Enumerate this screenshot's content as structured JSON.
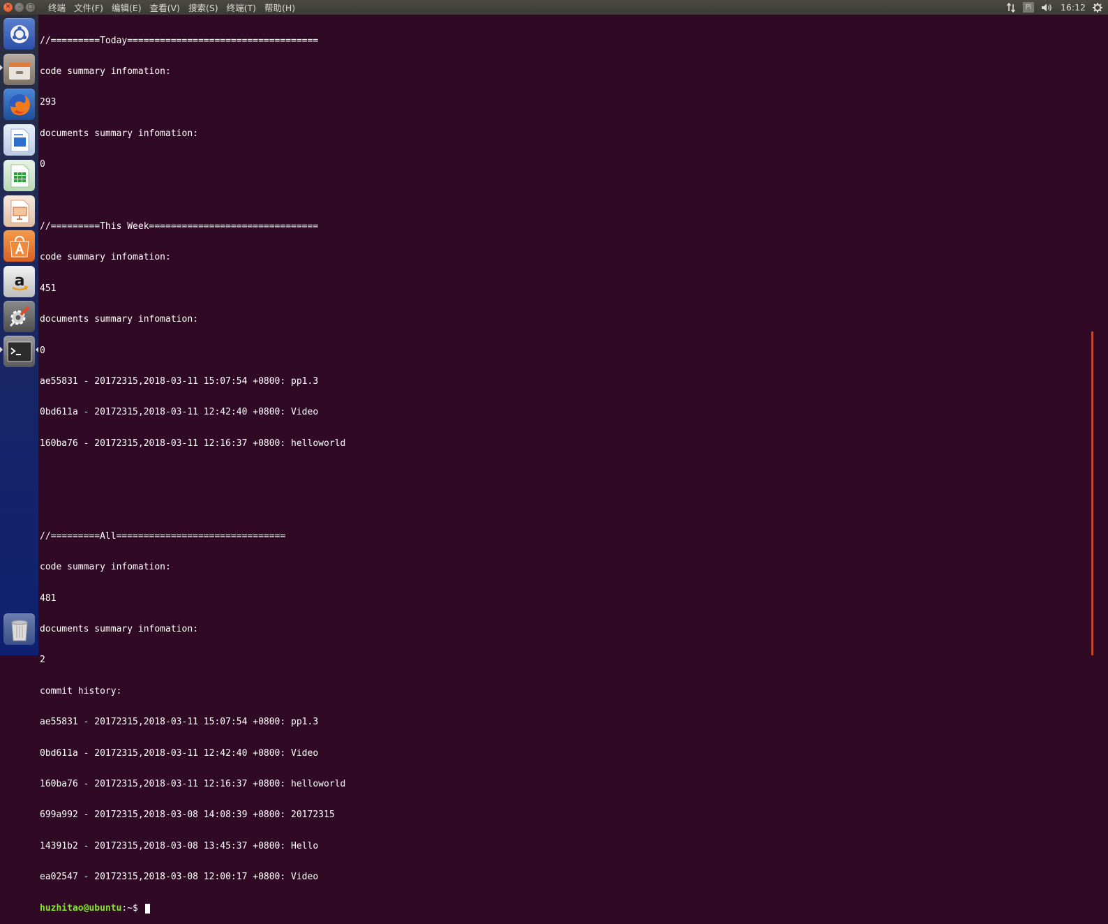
{
  "panel": {
    "app_name": "终端",
    "menu": [
      {
        "label": "文件(F)"
      },
      {
        "label": "编辑(E)"
      },
      {
        "label": "查看(V)"
      },
      {
        "label": "搜索(S)"
      },
      {
        "label": "终端(T)"
      },
      {
        "label": "帮助(H)"
      }
    ],
    "keyboard_indicator": "Pi",
    "clock": "16:12",
    "icons": [
      "network-updown-icon",
      "keyboard-layout-icon",
      "volume-icon",
      "settings-gear-icon"
    ]
  },
  "launcher": {
    "items": [
      {
        "name": "dash-home-icon",
        "color": "#3a5fb8"
      },
      {
        "name": "files-icon",
        "color": "#8a7f72"
      },
      {
        "name": "firefox-icon",
        "color": "#1d62b2"
      },
      {
        "name": "writer-icon",
        "color": "#2a6fd0"
      },
      {
        "name": "calc-icon",
        "color": "#2f9a3c"
      },
      {
        "name": "impress-icon",
        "color": "#c4602a"
      },
      {
        "name": "software-center-icon",
        "color": "#e2772a"
      },
      {
        "name": "amazon-icon",
        "color": "#d9d9d9"
      },
      {
        "name": "system-settings-icon",
        "color": "#6e6e6e"
      },
      {
        "name": "terminal-icon",
        "color": "#3b3b3b"
      },
      {
        "name": "trash-icon",
        "color": "#9a9a9a"
      }
    ]
  },
  "terminal": {
    "lines": [
      "//=========Today===================================",
      "code summary infomation:",
      "293",
      "documents summary infomation:",
      "0",
      "",
      "//=========This Week===============================",
      "code summary infomation:",
      "451",
      "documents summary infomation:",
      "0",
      "ae55831 - 20172315,2018-03-11 15:07:54 +0800: pp1.3",
      "0bd611a - 20172315,2018-03-11 12:42:40 +0800: Video",
      "160ba76 - 20172315,2018-03-11 12:16:37 +0800: helloworld",
      "",
      "",
      "//=========All===============================",
      "code summary infomation:",
      "481",
      "documents summary infomation:",
      "2",
      "commit history:",
      "ae55831 - 20172315,2018-03-11 15:07:54 +0800: pp1.3",
      "0bd611a - 20172315,2018-03-11 12:42:40 +0800: Video",
      "160ba76 - 20172315,2018-03-11 12:16:37 +0800: helloworld",
      "699a992 - 20172315,2018-03-08 14:08:39 +0800: 20172315",
      "14391b2 - 20172315,2018-03-08 13:45:37 +0800: Hello",
      "ea02547 - 20172315,2018-03-08 12:00:17 +0800: Video"
    ],
    "prompt_user": "huzhitao@ubuntu",
    "prompt_path": ":~$ "
  }
}
